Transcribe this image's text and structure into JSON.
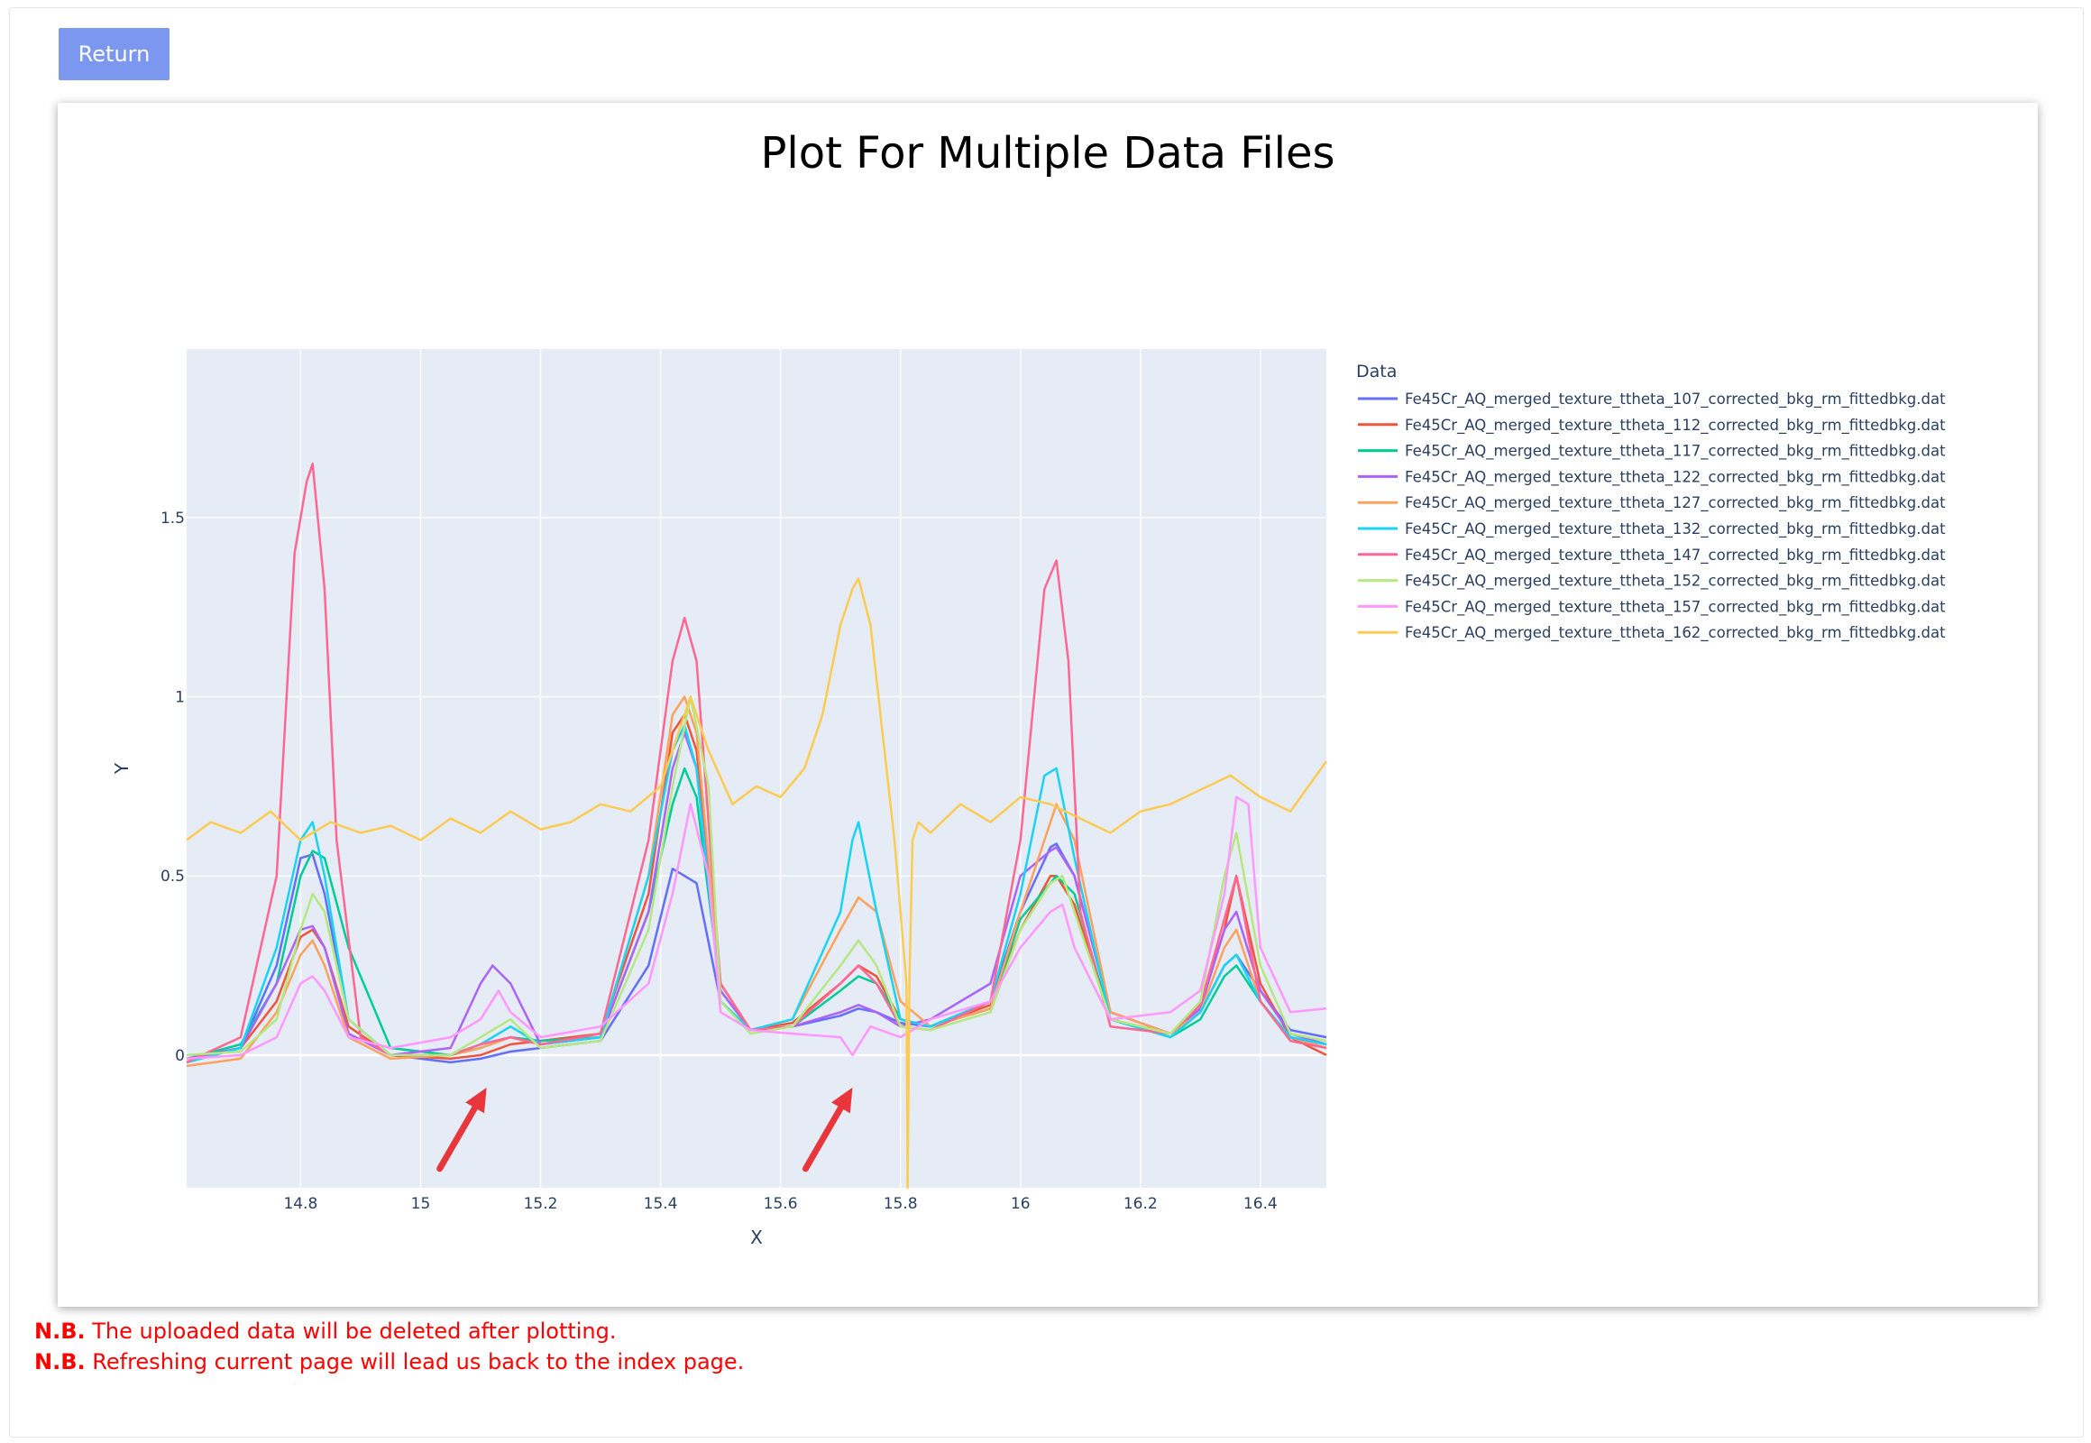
{
  "toolbar": {
    "return_label": "Return"
  },
  "notes": [
    {
      "prefix": "N.B.",
      "text": "The uploaded data will be deleted after plotting."
    },
    {
      "prefix": "N.B.",
      "text": "Refreshing current page will lead us back to the index page."
    }
  ],
  "colors": {
    "plot_bg": "#e5ecf6",
    "annotation_arrow": "#e8363c"
  },
  "chart_data": {
    "type": "line",
    "title": "Plot For Multiple Data Files",
    "xlabel": "X",
    "ylabel": "Y",
    "xlim": [
      14.61,
      16.51
    ],
    "ylim": [
      -0.37,
      1.97
    ],
    "xticks": [
      14.8,
      15,
      15.2,
      15.4,
      15.6,
      15.8,
      16,
      16.2,
      16.4
    ],
    "xtick_labels": [
      "14.8",
      "15",
      "15.2",
      "15.4",
      "15.6",
      "15.8",
      "16",
      "16.2",
      "16.4"
    ],
    "yticks": [
      0,
      0.5,
      1,
      1.5
    ],
    "ytick_labels": [
      "0",
      "0.5",
      "1",
      "1.5"
    ],
    "grid": true,
    "legend_title": "Data",
    "legend_position": "right",
    "annotations": [
      {
        "type": "arrow",
        "x": 15.11,
        "y": -0.05
      },
      {
        "type": "arrow",
        "x": 15.72,
        "y": -0.05
      }
    ],
    "series": [
      {
        "name": "Fe45Cr_AQ_merged_texture_ttheta_107_corrected_bkg_rm_fittedbkg.dat",
        "color": "#636efa",
        "x": [
          14.61,
          14.7,
          14.76,
          14.8,
          14.82,
          14.84,
          14.88,
          14.95,
          15.05,
          15.1,
          15.15,
          15.2,
          15.3,
          15.38,
          15.42,
          15.44,
          15.46,
          15.5,
          15.55,
          15.62,
          15.7,
          15.73,
          15.76,
          15.8,
          15.85,
          15.95,
          16.0,
          16.05,
          16.06,
          16.09,
          16.15,
          16.25,
          16.3,
          16.34,
          16.36,
          16.4,
          16.45,
          16.51
        ],
        "y": [
          -0.02,
          0.02,
          0.25,
          0.55,
          0.56,
          0.45,
          0.1,
          0.0,
          -0.02,
          -0.01,
          0.01,
          0.02,
          0.04,
          0.25,
          0.52,
          0.5,
          0.48,
          0.15,
          0.07,
          0.08,
          0.11,
          0.13,
          0.12,
          0.09,
          0.08,
          0.15,
          0.4,
          0.58,
          0.59,
          0.5,
          0.12,
          0.06,
          0.12,
          0.25,
          0.28,
          0.18,
          0.07,
          0.05
        ]
      },
      {
        "name": "Fe45Cr_AQ_merged_texture_ttheta_112_corrected_bkg_rm_fittedbkg.dat",
        "color": "#ef553b",
        "x": [
          14.61,
          14.7,
          14.76,
          14.8,
          14.82,
          14.84,
          14.88,
          14.95,
          15.05,
          15.1,
          15.15,
          15.2,
          15.3,
          15.38,
          15.42,
          15.44,
          15.46,
          15.5,
          15.55,
          15.62,
          15.7,
          15.73,
          15.76,
          15.8,
          15.85,
          15.95,
          16.0,
          16.05,
          16.06,
          16.09,
          16.15,
          16.25,
          16.3,
          16.34,
          16.36,
          16.4,
          16.45,
          16.51
        ],
        "y": [
          -0.01,
          0.02,
          0.15,
          0.33,
          0.35,
          0.3,
          0.08,
          0.0,
          -0.01,
          0.0,
          0.03,
          0.04,
          0.06,
          0.45,
          0.9,
          0.95,
          0.85,
          0.2,
          0.07,
          0.09,
          0.2,
          0.25,
          0.22,
          0.1,
          0.08,
          0.14,
          0.35,
          0.5,
          0.5,
          0.42,
          0.1,
          0.06,
          0.14,
          0.35,
          0.5,
          0.2,
          0.05,
          0.0
        ]
      },
      {
        "name": "Fe45Cr_AQ_merged_texture_ttheta_117_corrected_bkg_rm_fittedbkg.dat",
        "color": "#00cc96",
        "x": [
          14.61,
          14.7,
          14.76,
          14.8,
          14.82,
          14.84,
          14.88,
          14.95,
          15.05,
          15.1,
          15.15,
          15.2,
          15.3,
          15.38,
          15.42,
          15.44,
          15.46,
          15.5,
          15.55,
          15.62,
          15.7,
          15.73,
          15.76,
          15.8,
          15.85,
          15.95,
          16.0,
          16.05,
          16.06,
          16.09,
          16.15,
          16.25,
          16.3,
          16.34,
          16.36,
          16.4,
          16.45,
          16.51
        ],
        "y": [
          -0.01,
          0.03,
          0.2,
          0.5,
          0.57,
          0.55,
          0.3,
          0.02,
          0.0,
          0.02,
          0.05,
          0.04,
          0.05,
          0.4,
          0.7,
          0.8,
          0.72,
          0.18,
          0.07,
          0.08,
          0.18,
          0.22,
          0.2,
          0.1,
          0.08,
          0.13,
          0.38,
          0.48,
          0.5,
          0.45,
          0.1,
          0.05,
          0.1,
          0.22,
          0.25,
          0.15,
          0.05,
          0.03
        ]
      },
      {
        "name": "Fe45Cr_AQ_merged_texture_ttheta_122_corrected_bkg_rm_fittedbkg.dat",
        "color": "#ab63fa",
        "x": [
          14.61,
          14.7,
          14.76,
          14.8,
          14.82,
          14.84,
          14.88,
          14.95,
          15.05,
          15.1,
          15.12,
          15.15,
          15.2,
          15.3,
          15.38,
          15.42,
          15.44,
          15.46,
          15.5,
          15.55,
          15.62,
          15.7,
          15.73,
          15.76,
          15.8,
          15.85,
          15.95,
          16.0,
          16.05,
          16.06,
          16.09,
          16.15,
          16.25,
          16.3,
          16.34,
          16.36,
          16.4,
          16.45,
          16.51
        ],
        "y": [
          -0.01,
          0.02,
          0.2,
          0.35,
          0.36,
          0.3,
          0.06,
          0.0,
          0.02,
          0.2,
          0.25,
          0.2,
          0.03,
          0.05,
          0.4,
          0.8,
          0.9,
          0.8,
          0.18,
          0.07,
          0.08,
          0.12,
          0.14,
          0.12,
          0.08,
          0.1,
          0.2,
          0.5,
          0.57,
          0.58,
          0.5,
          0.12,
          0.06,
          0.13,
          0.35,
          0.4,
          0.18,
          0.06,
          0.03
        ]
      },
      {
        "name": "Fe45Cr_AQ_merged_texture_ttheta_127_corrected_bkg_rm_fittedbkg.dat",
        "color": "#ffa15a",
        "x": [
          14.61,
          14.7,
          14.76,
          14.8,
          14.82,
          14.84,
          14.88,
          14.95,
          15.05,
          15.1,
          15.15,
          15.2,
          15.3,
          15.38,
          15.42,
          15.44,
          15.46,
          15.5,
          15.55,
          15.62,
          15.7,
          15.73,
          15.76,
          15.8,
          15.85,
          15.95,
          16.0,
          16.05,
          16.06,
          16.09,
          16.15,
          16.25,
          16.3,
          16.34,
          16.36,
          16.4,
          16.45,
          16.51
        ],
        "y": [
          -0.03,
          -0.01,
          0.12,
          0.28,
          0.32,
          0.25,
          0.05,
          -0.01,
          0.0,
          0.02,
          0.05,
          0.03,
          0.05,
          0.5,
          0.95,
          1.0,
          0.9,
          0.2,
          0.07,
          0.1,
          0.35,
          0.44,
          0.4,
          0.15,
          0.08,
          0.13,
          0.4,
          0.65,
          0.7,
          0.6,
          0.12,
          0.06,
          0.12,
          0.3,
          0.35,
          0.15,
          0.05,
          0.02
        ]
      },
      {
        "name": "Fe45Cr_AQ_merged_texture_ttheta_132_corrected_bkg_rm_fittedbkg.dat",
        "color": "#19d3f3",
        "x": [
          14.61,
          14.7,
          14.76,
          14.8,
          14.82,
          14.84,
          14.88,
          14.95,
          15.05,
          15.1,
          15.15,
          15.2,
          15.3,
          15.38,
          15.42,
          15.44,
          15.46,
          15.5,
          15.55,
          15.62,
          15.7,
          15.72,
          15.73,
          15.76,
          15.8,
          15.85,
          15.95,
          16.0,
          16.04,
          16.06,
          16.09,
          16.15,
          16.25,
          16.3,
          16.34,
          16.36,
          16.4,
          16.45,
          16.51
        ],
        "y": [
          -0.02,
          0.02,
          0.3,
          0.6,
          0.65,
          0.5,
          0.1,
          0.0,
          0.0,
          0.03,
          0.08,
          0.03,
          0.05,
          0.5,
          0.85,
          0.92,
          0.8,
          0.15,
          0.07,
          0.1,
          0.4,
          0.6,
          0.65,
          0.4,
          0.1,
          0.08,
          0.15,
          0.45,
          0.78,
          0.8,
          0.55,
          0.1,
          0.05,
          0.12,
          0.25,
          0.28,
          0.15,
          0.05,
          0.03
        ]
      },
      {
        "name": "Fe45Cr_AQ_merged_texture_ttheta_147_corrected_bkg_rm_fittedbkg.dat",
        "color": "#ff6692",
        "x": [
          14.61,
          14.7,
          14.76,
          14.79,
          14.81,
          14.82,
          14.84,
          14.86,
          14.9,
          14.95,
          15.05,
          15.1,
          15.15,
          15.2,
          15.3,
          15.38,
          15.42,
          15.44,
          15.46,
          15.5,
          15.55,
          15.62,
          15.7,
          15.73,
          15.76,
          15.8,
          15.85,
          15.95,
          16.0,
          16.04,
          16.06,
          16.08,
          16.1,
          16.15,
          16.25,
          16.3,
          16.34,
          16.36,
          16.4,
          16.45,
          16.51
        ],
        "y": [
          -0.02,
          0.05,
          0.5,
          1.4,
          1.6,
          1.65,
          1.3,
          0.6,
          0.05,
          0.0,
          0.0,
          0.03,
          0.05,
          0.03,
          0.06,
          0.6,
          1.1,
          1.22,
          1.1,
          0.2,
          0.07,
          0.08,
          0.2,
          0.25,
          0.2,
          0.08,
          0.07,
          0.15,
          0.6,
          1.3,
          1.38,
          1.1,
          0.4,
          0.08,
          0.06,
          0.14,
          0.38,
          0.5,
          0.15,
          0.04,
          0.02
        ]
      },
      {
        "name": "Fe45Cr_AQ_merged_texture_ttheta_152_corrected_bkg_rm_fittedbkg.dat",
        "color": "#b6e880",
        "x": [
          14.61,
          14.7,
          14.76,
          14.8,
          14.82,
          14.84,
          14.88,
          14.95,
          15.05,
          15.1,
          15.15,
          15.2,
          15.3,
          15.38,
          15.42,
          15.45,
          15.48,
          15.5,
          15.55,
          15.62,
          15.7,
          15.73,
          15.76,
          15.8,
          15.85,
          15.95,
          16.0,
          16.05,
          16.07,
          16.09,
          16.15,
          16.25,
          16.3,
          16.34,
          16.36,
          16.4,
          16.45,
          16.51
        ],
        "y": [
          0.0,
          0.01,
          0.1,
          0.35,
          0.45,
          0.4,
          0.1,
          0.0,
          0.0,
          0.05,
          0.1,
          0.02,
          0.04,
          0.35,
          0.75,
          1.0,
          0.75,
          0.15,
          0.06,
          0.08,
          0.25,
          0.32,
          0.25,
          0.08,
          0.07,
          0.12,
          0.35,
          0.48,
          0.5,
          0.4,
          0.1,
          0.06,
          0.15,
          0.5,
          0.62,
          0.25,
          0.06,
          0.04
        ]
      },
      {
        "name": "Fe45Cr_AQ_merged_texture_ttheta_157_corrected_bkg_rm_fittedbkg.dat",
        "color": "#ff97ff",
        "x": [
          14.61,
          14.7,
          14.76,
          14.8,
          14.82,
          14.84,
          14.88,
          14.95,
          15.05,
          15.1,
          15.13,
          15.15,
          15.2,
          15.3,
          15.38,
          15.42,
          15.45,
          15.48,
          15.5,
          15.55,
          15.62,
          15.7,
          15.72,
          15.75,
          15.8,
          15.85,
          15.95,
          16.0,
          16.05,
          16.07,
          16.09,
          16.15,
          16.25,
          16.3,
          16.34,
          16.36,
          16.38,
          16.4,
          16.45,
          16.51
        ],
        "y": [
          -0.01,
          0.0,
          0.05,
          0.2,
          0.22,
          0.18,
          0.05,
          0.02,
          0.05,
          0.1,
          0.18,
          0.12,
          0.05,
          0.08,
          0.2,
          0.45,
          0.7,
          0.5,
          0.12,
          0.07,
          0.06,
          0.05,
          0.0,
          0.08,
          0.05,
          0.1,
          0.15,
          0.3,
          0.4,
          0.42,
          0.3,
          0.1,
          0.12,
          0.18,
          0.45,
          0.72,
          0.7,
          0.3,
          0.12,
          0.13
        ]
      },
      {
        "name": "Fe45Cr_AQ_merged_texture_ttheta_162_corrected_bkg_rm_fittedbkg.dat",
        "color": "#fecb52",
        "x": [
          14.61,
          14.65,
          14.7,
          14.75,
          14.8,
          14.85,
          14.9,
          14.95,
          15.0,
          15.05,
          15.1,
          15.15,
          15.2,
          15.25,
          15.3,
          15.35,
          15.4,
          15.43,
          15.45,
          15.48,
          15.52,
          15.56,
          15.6,
          15.64,
          15.67,
          15.7,
          15.72,
          15.73,
          15.75,
          15.77,
          15.79,
          15.81,
          15.812,
          15.815,
          15.82,
          15.83,
          15.85,
          15.9,
          15.95,
          16.0,
          16.05,
          16.1,
          16.15,
          16.2,
          16.25,
          16.3,
          16.35,
          16.4,
          16.45,
          16.51
        ],
        "y": [
          0.6,
          0.65,
          0.62,
          0.68,
          0.6,
          0.65,
          0.62,
          0.64,
          0.6,
          0.66,
          0.62,
          0.68,
          0.63,
          0.65,
          0.7,
          0.68,
          0.75,
          0.9,
          1.0,
          0.85,
          0.7,
          0.75,
          0.72,
          0.8,
          0.95,
          1.2,
          1.3,
          1.33,
          1.2,
          0.9,
          0.6,
          0.2,
          -0.37,
          0.2,
          0.6,
          0.65,
          0.62,
          0.7,
          0.65,
          0.72,
          0.7,
          0.66,
          0.62,
          0.68,
          0.7,
          0.74,
          0.78,
          0.72,
          0.68,
          0.82
        ]
      }
    ]
  }
}
